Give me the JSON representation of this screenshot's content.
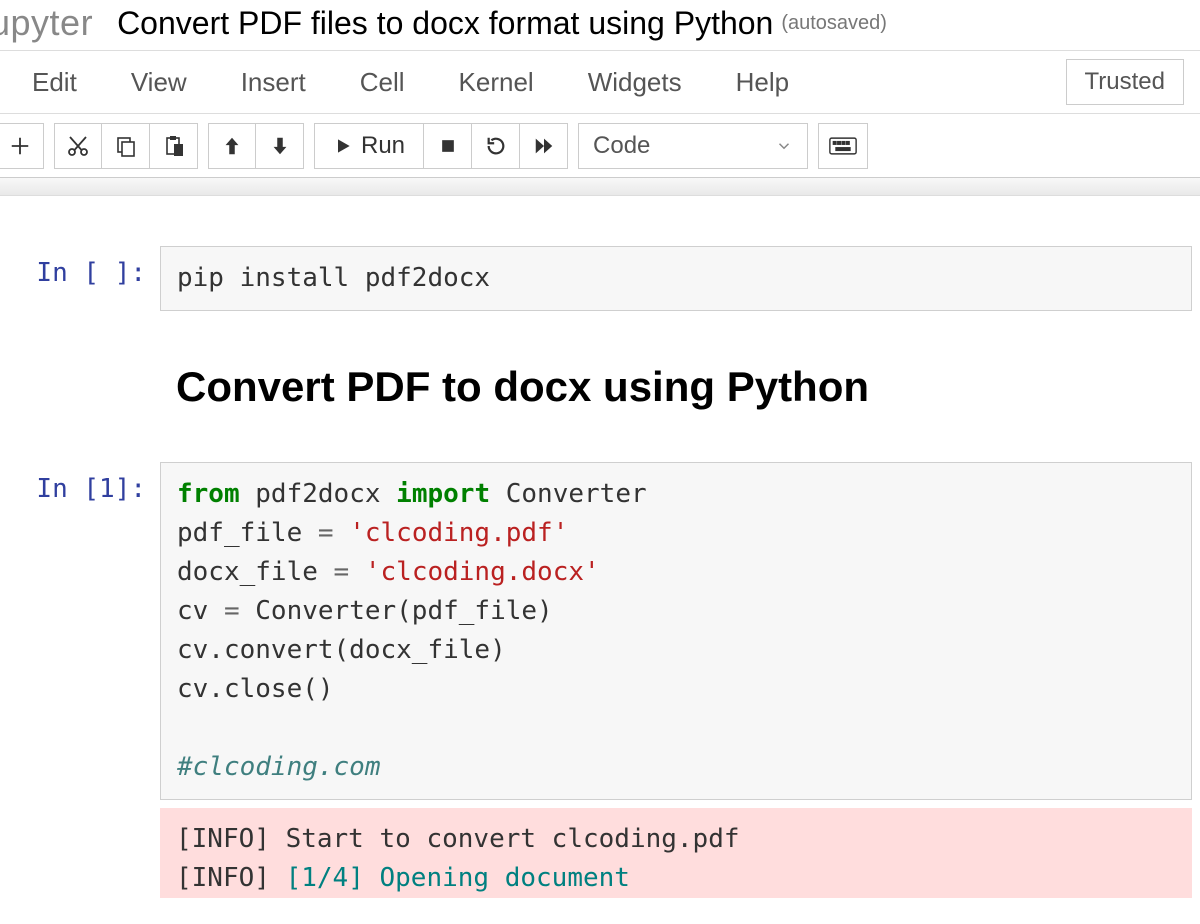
{
  "header": {
    "logo": "upyter",
    "title": "Convert PDF files to docx format using Python",
    "autosaved": "(autosaved)"
  },
  "menubar": {
    "items": [
      "Edit",
      "View",
      "Insert",
      "Cell",
      "Kernel",
      "Widgets",
      "Help"
    ],
    "trusted": "Trusted"
  },
  "toolbar": {
    "add_icon": "add-icon",
    "cut_icon": "cut-icon",
    "copy_icon": "copy-icon",
    "paste_icon": "paste-icon",
    "up_icon": "arrow-up-icon",
    "down_icon": "arrow-down-icon",
    "run_icon": "play-icon",
    "run_label": "Run",
    "stop_icon": "stop-icon",
    "restart_icon": "restart-icon",
    "restart_fwd_icon": "fast-forward-icon",
    "celltype_selected": "Code",
    "cmd_icon": "keyboard-icon"
  },
  "cells": [
    {
      "type": "code",
      "prompt": "In [ ]:",
      "source": "pip install pdf2docx"
    },
    {
      "type": "markdown",
      "heading": "Convert PDF to docx using Python"
    },
    {
      "type": "code",
      "prompt": "In [1]:",
      "code_tokens": {
        "kw_from": "from",
        "mod": "pdf2docx",
        "kw_import": "import",
        "cls": "Converter",
        "l2a": "pdf_file ",
        "eq": "=",
        "l2b": " ",
        "s1": "'clcoding.pdf'",
        "l3a": "docx_file ",
        "s2": "'clcoding.docx'",
        "l4": "cv ",
        "l4b": " Converter(pdf_file)",
        "l5": "cv.convert(docx_file)",
        "l6": "cv.close()",
        "blank": "",
        "comment": "#clcoding.com"
      },
      "output": {
        "line1": "[INFO] Start to convert clcoding.pdf",
        "line2_pre": "[INFO] ",
        "line2_hl": "[1/4] Opening document",
        "line2_post": ""
      }
    }
  ]
}
